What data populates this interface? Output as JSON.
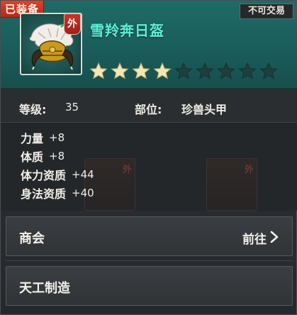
{
  "badges": {
    "equipped": "已装备",
    "trade": "不可交易"
  },
  "item": {
    "name": "雪羚奔日盔",
    "tag": "外",
    "icon": "beast-horn-helmet-icon",
    "stars_filled": 4,
    "stars_total": 9,
    "color_name": "#5ff0d6",
    "color_star_filled": "#f3e7b6",
    "color_star_empty": "#1f3f3d"
  },
  "info": {
    "level_label": "等级:",
    "level_value": "35",
    "slot_label": "部位:",
    "slot_value": "珍兽头甲"
  },
  "stats": [
    {
      "name": "力量",
      "value": "+8"
    },
    {
      "name": "体质",
      "value": "+8"
    },
    {
      "name": "体力资质",
      "value": "+44"
    },
    {
      "name": "身法资质",
      "value": "+40"
    }
  ],
  "background_cards": [
    {
      "tag": "外"
    },
    {
      "tag": "外"
    }
  ],
  "actions": {
    "shop_label": "商会",
    "shop_go": "前往",
    "craft_label": "天工制造"
  }
}
